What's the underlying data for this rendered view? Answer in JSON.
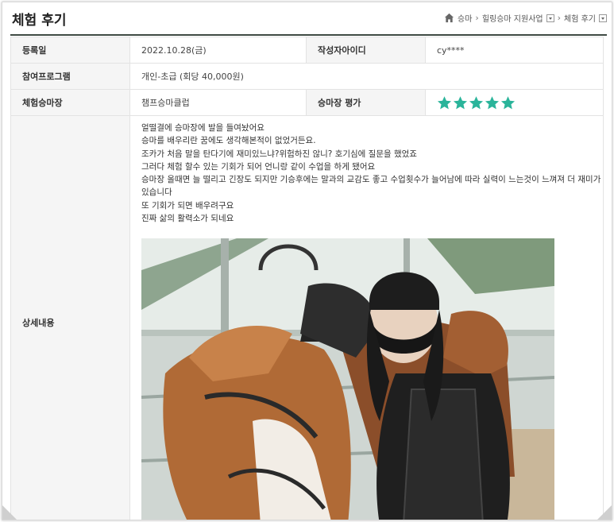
{
  "page": {
    "title": "체험 후기"
  },
  "breadcrumb": {
    "items": [
      "승마",
      "힐링승마 지원사업",
      "체험 후기"
    ]
  },
  "info": {
    "registered_label": "등록일",
    "registered_value": "2022.10.28(금)",
    "author_label": "작성자아이디",
    "author_value": "cy****",
    "program_label": "참여프로그램",
    "program_value": "개인-초급 (회당 40,000원)",
    "venue_label": "체험승마장",
    "venue_value": "챔프승마클럽",
    "rating_label": "승마장 평가",
    "rating": 5,
    "rating_max": 5,
    "details_label": "상세내용"
  },
  "content": {
    "lines": [
      "얼떨결에 승마장에 발을 들여놨어요",
      "승마를 배우리란 꿈에도 생각해본적이 없었거든요.",
      "조카가 처음 말을 탄다기에 재미있느냐?위험하진 않니? 호기심에 질문을 했었죠",
      "그러다 체험 할수 있는 기회가 되어 언니랑 같이 수업을 하게 됐어요",
      "승마장 올때면 늘 떨리고 긴장도 되지만 기승후에는 말과의 교감도 좋고 수업횟수가 늘어남에 따라 실력이 느는것이 느껴져 더 재미가 있습니다",
      "또 기회가 되면 배우려구요",
      "진짜 삶의 활력소가 되네요"
    ]
  },
  "colors": {
    "star": "#2ab49a",
    "header_rule": "#3f4b44",
    "label_bg": "#f5f5f5"
  }
}
